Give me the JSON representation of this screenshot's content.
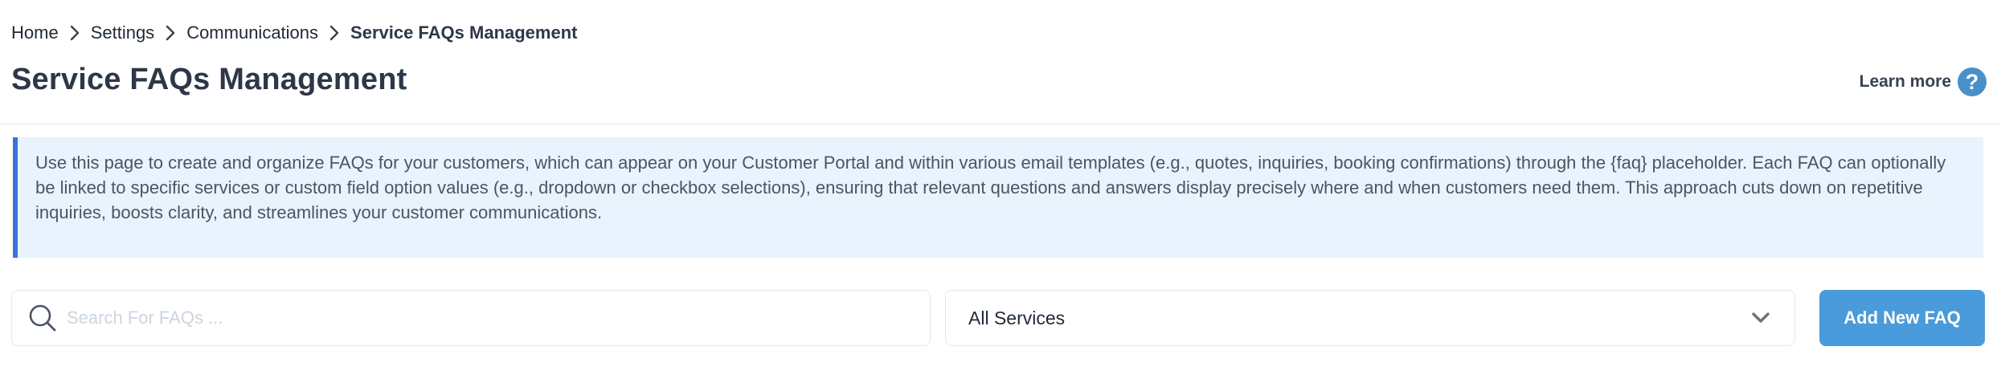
{
  "breadcrumb": {
    "items": [
      "Home",
      "Settings",
      "Communications"
    ],
    "current": "Service FAQs Management"
  },
  "page": {
    "title": "Service FAQs Management",
    "learn_more": "Learn more",
    "help_glyph": "?"
  },
  "info": {
    "text": "Use this page to create and organize FAQs for your customers, which can appear on your Customer Portal and within various email templates (e.g., quotes, inquiries, booking confirmations) through the {faq} placeholder. Each FAQ can optionally be linked to specific services or custom field option values (e.g., dropdown or checkbox selections), ensuring that relevant questions and answers display precisely where and when customers need them. This approach cuts down on repetitive inquiries, boosts clarity, and streamlines your customer communications."
  },
  "search": {
    "placeholder": "Search For FAQs ...",
    "value": ""
  },
  "services_filter": {
    "selected": "All Services"
  },
  "actions": {
    "add_label": "Add New FAQ"
  },
  "icons": {
    "breadcrumb_separator": "chevron-right-icon",
    "search": "search-icon",
    "select_caret": "chevron-down-icon",
    "help": "help-circle-icon"
  },
  "colors": {
    "accent_button": "#4a9bdb",
    "info_background": "#e8f3fd",
    "info_border": "#3b73d9",
    "help_icon": "#4a90c8",
    "heading": "#2d3748"
  }
}
